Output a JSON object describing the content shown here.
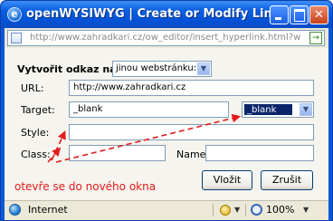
{
  "window": {
    "title": "openWYSIWYG | Create or Modify Link ...",
    "app_icon_letter": "e",
    "minimize_glyph": "",
    "close_glyph": "✕"
  },
  "address": {
    "url": "http://www.zahradkari.cz/ow_editor/insert_hyperlink.html?w",
    "go_glyph": "→"
  },
  "form": {
    "link_type_label": "Vytvořit odkaz na:",
    "link_type_value": "jinou webstránku:",
    "url_label": "URL:",
    "url_value": "http://www.zahradkari.cz",
    "target_label": "Target:",
    "target_value": "_blank",
    "target_select_value": "_blank",
    "style_label": "Style:",
    "style_value": "",
    "class_label": "Class:",
    "class_value": "",
    "name_label": "Name:",
    "name_value": ""
  },
  "annotation": {
    "text": "otevře se do nového okna",
    "color": "#e31b1b"
  },
  "buttons": {
    "insert": "Vložit",
    "cancel": "Zrušit"
  },
  "status": {
    "zone": "Internet",
    "zoom": "100%"
  },
  "colors": {
    "titlebar": "#0b5fe0",
    "selection": "#0a246a",
    "arrow": "#e31b1b"
  }
}
